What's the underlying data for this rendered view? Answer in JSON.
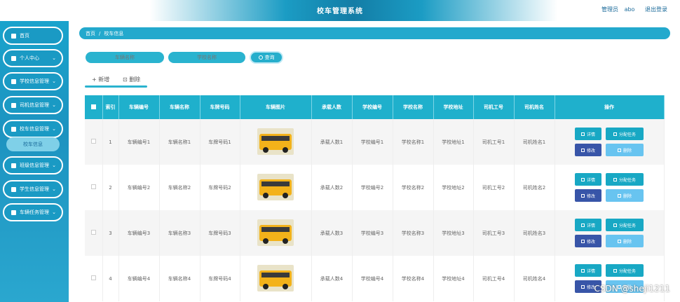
{
  "header": {
    "title": "校车管理系统",
    "user_role": "管理员",
    "username": "abo",
    "logout": "退出登录"
  },
  "sidebar": {
    "items": [
      {
        "label": "首页",
        "icon": "home-icon"
      },
      {
        "label": "个人中心",
        "icon": "user-icon"
      },
      {
        "label": "学校信息管理",
        "icon": "grid-icon"
      },
      {
        "label": "司机信息管理",
        "icon": "grid-icon"
      },
      {
        "label": "校车信息管理",
        "icon": "bus-icon"
      },
      {
        "label": "班级信息管理",
        "icon": "lock-icon"
      },
      {
        "label": "学生信息管理",
        "icon": "chart-icon"
      },
      {
        "label": "车辆任务管理",
        "icon": "grid-icon"
      }
    ],
    "submenu": {
      "label": "校车信息"
    }
  },
  "breadcrumb": {
    "home": "首页",
    "sep": "/",
    "current": "校车信息"
  },
  "search": {
    "vehicle_name_placeholder": "车辆名称",
    "school_name_placeholder": "学校名称",
    "button_label": "查询"
  },
  "actions": {
    "add": "+ 新增",
    "delete": "⊡ 删除"
  },
  "table": {
    "headers": [
      "索引",
      "车辆编号",
      "车辆名称",
      "车牌号码",
      "车辆图片",
      "承载人数",
      "学校编号",
      "学校名称",
      "学校地址",
      "司机工号",
      "司机姓名",
      "操作"
    ],
    "rows": [
      {
        "index": "1",
        "vehicle_no": "车辆编号1",
        "vehicle_name": "车辆名称1",
        "plate": "车牌号码1",
        "capacity": "承载人数1",
        "school_no": "学校编号1",
        "school_name": "学校名称1",
        "school_addr": "学校地址1",
        "driver_no": "司机工号1",
        "driver_name": "司机姓名1"
      },
      {
        "index": "2",
        "vehicle_no": "车辆编号2",
        "vehicle_name": "车辆名称2",
        "plate": "车牌号码2",
        "capacity": "承载人数2",
        "school_no": "学校编号2",
        "school_name": "学校名称2",
        "school_addr": "学校地址2",
        "driver_no": "司机工号2",
        "driver_name": "司机姓名2"
      },
      {
        "index": "3",
        "vehicle_no": "车辆编号3",
        "vehicle_name": "车辆名称3",
        "plate": "车牌号码3",
        "capacity": "承载人数3",
        "school_no": "学校编号3",
        "school_name": "学校名称3",
        "school_addr": "学校地址3",
        "driver_no": "司机工号3",
        "driver_name": "司机姓名3"
      },
      {
        "index": "4",
        "vehicle_no": "车辆编号4",
        "vehicle_name": "车辆名称4",
        "plate": "车牌号码4",
        "capacity": "承载人数4",
        "school_no": "学校编号4",
        "school_name": "学校名称4",
        "school_addr": "学校地址4",
        "driver_no": "司机工号4",
        "driver_name": "司机姓名4"
      }
    ],
    "row_buttons": {
      "detail": "详情",
      "assign": "分配任务",
      "edit": "修改",
      "remove": "删除"
    }
  },
  "watermark": "CSDN @sheji1211",
  "colors": {
    "primary": "#1fb0cc",
    "sidebar": "#1d93c0",
    "edit": "#3855a8",
    "remove": "#68c4f0"
  }
}
